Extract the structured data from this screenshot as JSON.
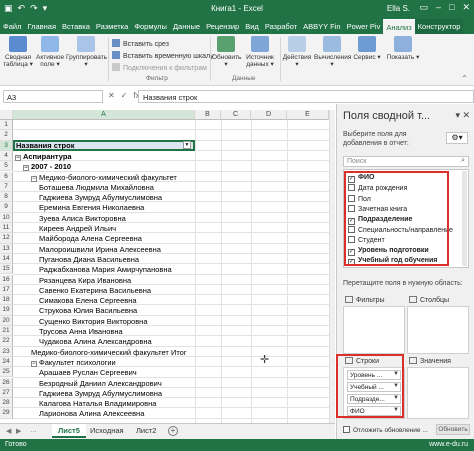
{
  "titlebar": {
    "title": "Книга1 - Excel",
    "user": "Ella S."
  },
  "tabs": [
    "Файл",
    "Главная",
    "Вставка",
    "Разметка",
    "Формулы",
    "Данные",
    "Рецензир",
    "Вид",
    "Разработ",
    "ABBYY Fin",
    "Power Piv",
    "Анализ",
    "Конструктор"
  ],
  "ribbon": {
    "buttons": {
      "pivot_table": "Сводная таблица",
      "active_field": "Активное поле",
      "group": "Группировать",
      "refresh": "Обновить",
      "data_source": "Источник данных",
      "actions": "Действия",
      "calculations": "Вычисления",
      "service": "Сервис",
      "show": "Показать"
    },
    "filter_cmds": {
      "insert_slicer": "Вставить срез",
      "insert_timeline": "Вставить временную шкалу",
      "filter_connections": "Подключения к фильтрам"
    },
    "group_labels": {
      "filter": "Фильтр",
      "data": "Данные"
    }
  },
  "formula_bar": {
    "name_box": "A3",
    "value": "Названия строк"
  },
  "grid": {
    "columns": [
      "A",
      "B",
      "C",
      "D",
      "E"
    ],
    "row_numbers": [
      "1",
      "2",
      "3",
      "4",
      "5",
      "6",
      "7",
      "8",
      "9",
      "10",
      "11",
      "12",
      "13",
      "14",
      "15",
      "16",
      "17",
      "18",
      "19",
      "20",
      "21",
      "22",
      "23",
      "24",
      "25",
      "26",
      "27",
      "28",
      "29"
    ],
    "header_cell": "Названия строк",
    "rows": [
      {
        "row": 4,
        "indent": 0,
        "exp": "⊟",
        "text": "Аспирантура",
        "bold": true
      },
      {
        "row": 5,
        "indent": 1,
        "exp": "⊟",
        "text": "2007 - 2010",
        "bold": true
      },
      {
        "row": 6,
        "indent": 2,
        "exp": "⊟",
        "text": "Медико-биолого-химический факультет",
        "bold": false
      },
      {
        "row": 7,
        "indent": 3,
        "exp": "",
        "text": "Боташева Людмила Михайловна",
        "bold": false
      },
      {
        "row": 8,
        "indent": 3,
        "exp": "",
        "text": "Гаджиева Зумруд Абулмуслимовна",
        "bold": false
      },
      {
        "row": 9,
        "indent": 3,
        "exp": "",
        "text": "Еремина Евгения Николаевна",
        "bold": false
      },
      {
        "row": 10,
        "indent": 3,
        "exp": "",
        "text": "Зуева Алиса Викторовна",
        "bold": false
      },
      {
        "row": 11,
        "indent": 3,
        "exp": "",
        "text": "Киреев Андрей Ильич",
        "bold": false
      },
      {
        "row": 12,
        "indent": 3,
        "exp": "",
        "text": "Майборода Алена Сергеевна",
        "bold": false
      },
      {
        "row": 13,
        "indent": 3,
        "exp": "",
        "text": "Малороишвили Ирина Алексеевна",
        "bold": false
      },
      {
        "row": 14,
        "indent": 3,
        "exp": "",
        "text": "Пуганова Диана Васильевна",
        "bold": false
      },
      {
        "row": 15,
        "indent": 3,
        "exp": "",
        "text": "Раджабханова Мария Амирчупановна",
        "bold": false
      },
      {
        "row": 16,
        "indent": 3,
        "exp": "",
        "text": "Рязанцева Кира Ивановна",
        "bold": false
      },
      {
        "row": 17,
        "indent": 3,
        "exp": "",
        "text": "Савенко Екатерина Васильевна",
        "bold": false
      },
      {
        "row": 18,
        "indent": 3,
        "exp": "",
        "text": "Симакова Елена Сергеевна",
        "bold": false
      },
      {
        "row": 19,
        "indent": 3,
        "exp": "",
        "text": "Струкова Юлия Васильевна",
        "bold": false
      },
      {
        "row": 20,
        "indent": 3,
        "exp": "",
        "text": "Сущенко Виктория Викторовна",
        "bold": false
      },
      {
        "row": 21,
        "indent": 3,
        "exp": "",
        "text": "Трусова Анна Ивановна",
        "bold": false
      },
      {
        "row": 22,
        "indent": 3,
        "exp": "",
        "text": "Чудакова Алина Александровна",
        "bold": false
      },
      {
        "row": 23,
        "indent": 2,
        "exp": "",
        "text": "Медико-биолого-химический факультет Итог",
        "bold": false
      },
      {
        "row": 24,
        "indent": 2,
        "exp": "⊟",
        "text": "Факультет психологии",
        "bold": false
      },
      {
        "row": 25,
        "indent": 3,
        "exp": "",
        "text": "Арашаев Руслан Сергеевич",
        "bold": false
      },
      {
        "row": 26,
        "indent": 3,
        "exp": "",
        "text": "Безродный Даниил Александрович",
        "bold": false
      },
      {
        "row": 27,
        "indent": 3,
        "exp": "",
        "text": "Гаджиева Зумруд Абулмуслимовна",
        "bold": false
      },
      {
        "row": 28,
        "indent": 3,
        "exp": "",
        "text": "Калагова Наталья Владимировна",
        "bold": false
      },
      {
        "row": 29,
        "indent": 3,
        "exp": "",
        "text": "Ларионова Алина Алексеевна",
        "bold": false
      }
    ]
  },
  "sheets": {
    "tabs": [
      "Лист5",
      "Исходная",
      "Лист2"
    ],
    "active": "Лист5"
  },
  "status": {
    "ready": "Готово",
    "zoom": "www.e-du.ru"
  },
  "pane": {
    "title": "Поля сводной т...",
    "subtitle": "Выберите поля для добавления в отчет:",
    "search_placeholder": "Поиск",
    "fields": [
      {
        "label": "ФИО",
        "checked": true,
        "bold": true
      },
      {
        "label": "Дата рождения",
        "checked": false,
        "bold": false
      },
      {
        "label": "Пол",
        "checked": false,
        "bold": false
      },
      {
        "label": "Зачетная книга",
        "checked": false,
        "bold": false
      },
      {
        "label": "Подразделение",
        "checked": true,
        "bold": true
      },
      {
        "label": "Специальность/направление",
        "checked": false,
        "bold": false
      },
      {
        "label": "Студент",
        "checked": false,
        "bold": false
      },
      {
        "label": "Уровень подготовки",
        "checked": true,
        "bold": true
      },
      {
        "label": "Учебный год обучения",
        "checked": true,
        "bold": true
      }
    ],
    "drag_hint": "Перетащите поля в нужную область:",
    "areas": {
      "filters": "Фильтры",
      "columns": "Столбцы",
      "rows": "Строки",
      "values": "Значения"
    },
    "row_items": [
      "Уровень ...",
      "Учебный ...",
      "Подразде...",
      "ФИО"
    ],
    "defer_label": "Отложить обновление ...",
    "update_label": "Обновить"
  }
}
